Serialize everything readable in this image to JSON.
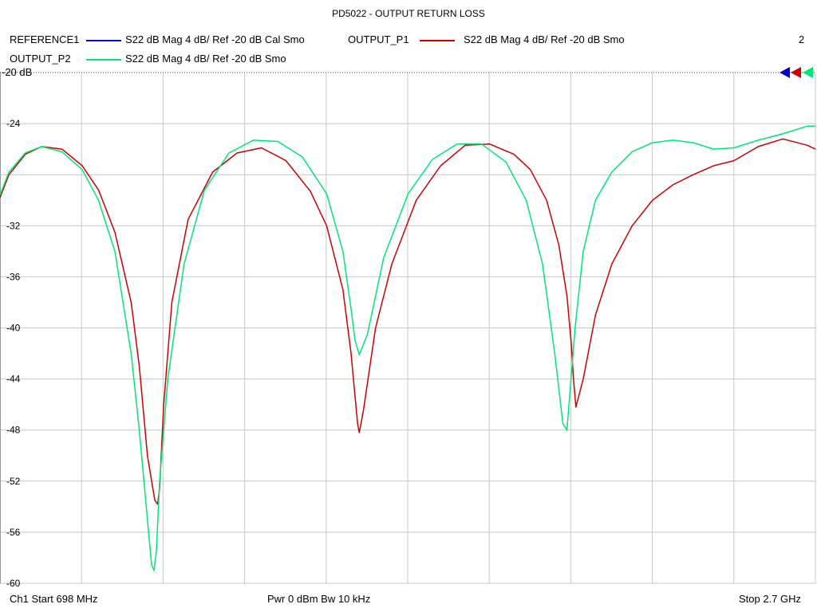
{
  "chart_data": {
    "type": "line",
    "title": "PD5022 - OUTPUT RETURN LOSS",
    "xlabel": "",
    "ylabel": "",
    "x_start_mhz": 698,
    "x_stop_mhz": 2700,
    "ylim": [
      -60,
      -20
    ],
    "yticks": [
      -24,
      -28,
      -32,
      -36,
      -40,
      -44,
      -48,
      -52,
      -56,
      -60
    ],
    "ytick_labels": [
      "-24",
      "",
      "-32",
      "-36",
      "-40",
      "-44",
      "-48",
      "-52",
      "-56",
      "-60"
    ],
    "ref_label": "-20 dB",
    "x_divisions": 10,
    "grid": true,
    "legend_position": "top",
    "series": [
      {
        "name": "REFERENCE1",
        "desc": "S22  dB Mag  4 dB/ Ref -20 dB  Cal Smo",
        "color": "#0000cc",
        "x": [],
        "y": []
      },
      {
        "name": "OUTPUT_P1",
        "desc": "S22  dB Mag  4 dB/ Ref -20 dB  Smo",
        "color": "#cc0000",
        "x": [
          698,
          720,
          760,
          800,
          850,
          900,
          940,
          980,
          1020,
          1040,
          1060,
          1078,
          1085,
          1090,
          1100,
          1120,
          1160,
          1220,
          1280,
          1340,
          1400,
          1460,
          1500,
          1540,
          1560,
          1576,
          1580,
          1590,
          1620,
          1660,
          1720,
          1780,
          1840,
          1900,
          1960,
          2000,
          2040,
          2070,
          2090,
          2100,
          2106,
          2112,
          2130,
          2160,
          2200,
          2250,
          2300,
          2350,
          2400,
          2450,
          2500,
          2560,
          2620,
          2680,
          2700
        ],
        "y": [
          -29.8,
          -28.0,
          -26.4,
          -25.8,
          -26.0,
          -27.3,
          -29.2,
          -32.5,
          -38.0,
          -43.0,
          -50.0,
          -53.5,
          -53.8,
          -52.5,
          -46.0,
          -38.0,
          -31.5,
          -27.8,
          -26.3,
          -25.9,
          -26.9,
          -29.3,
          -32.0,
          -37.0,
          -42.0,
          -47.5,
          -48.2,
          -46.5,
          -40.0,
          -35.0,
          -30.0,
          -27.3,
          -25.7,
          -25.6,
          -26.4,
          -27.6,
          -30.0,
          -33.5,
          -37.5,
          -41.0,
          -44.0,
          -46.2,
          -44.0,
          -39.0,
          -35.0,
          -32.0,
          -30.0,
          -28.8,
          -28.0,
          -27.3,
          -26.9,
          -25.8,
          -25.2,
          -25.7,
          -26.0
        ]
      },
      {
        "name": "OUTPUT_P2",
        "desc": "S22  dB Mag  4 dB/ Ref -20 dB  Smo",
        "color": "#00e676",
        "x": [
          698,
          720,
          760,
          800,
          850,
          900,
          940,
          980,
          1020,
          1040,
          1060,
          1070,
          1076,
          1082,
          1090,
          1110,
          1150,
          1200,
          1260,
          1320,
          1380,
          1440,
          1500,
          1540,
          1560,
          1570,
          1580,
          1600,
          1640,
          1700,
          1760,
          1820,
          1880,
          1940,
          1990,
          2030,
          2060,
          2080,
          2090,
          2100,
          2110,
          2130,
          2160,
          2200,
          2250,
          2300,
          2350,
          2400,
          2450,
          2500,
          2560,
          2620,
          2680,
          2700
        ],
        "y": [
          -29.6,
          -27.8,
          -26.3,
          -25.8,
          -26.2,
          -27.6,
          -30.0,
          -34.0,
          -42.0,
          -48.0,
          -55.0,
          -58.5,
          -59.0,
          -57.5,
          -52.0,
          -44.0,
          -35.0,
          -29.2,
          -26.3,
          -25.3,
          -25.4,
          -26.6,
          -29.5,
          -34.0,
          -38.5,
          -41.0,
          -42.1,
          -40.5,
          -34.5,
          -29.5,
          -26.8,
          -25.6,
          -25.6,
          -27.0,
          -30.0,
          -35.0,
          -42.0,
          -47.5,
          -48.0,
          -44.0,
          -40.0,
          -34.0,
          -30.0,
          -27.8,
          -26.2,
          -25.5,
          -25.3,
          -25.5,
          -26.0,
          -25.9,
          -25.3,
          -24.8,
          -24.2,
          -24.2
        ]
      }
    ]
  },
  "legend": {
    "row1": [
      {
        "name": "REFERENCE1",
        "desc": "S22  dB Mag  4 dB/ Ref -20 dB  Cal Smo"
      },
      {
        "name": "OUTPUT_P1",
        "desc": "S22  dB Mag  4 dB/ Ref -20 dB  Smo"
      }
    ],
    "row2": [
      {
        "name": "OUTPUT_P2",
        "desc": "S22  dB Mag  4 dB/ Ref -20 dB  Smo"
      }
    ],
    "channel_count": "2"
  },
  "footer": {
    "start": "Ch1  Start  698 MHz",
    "center": "Pwr  0 dBm  Bw  10 kHz",
    "stop": "Stop  2.7 GHz"
  },
  "colors": {
    "reference": "#0000cc",
    "output_p1": "#cc0000",
    "output_p2": "#00e676",
    "grid": "#c8c8c8"
  }
}
